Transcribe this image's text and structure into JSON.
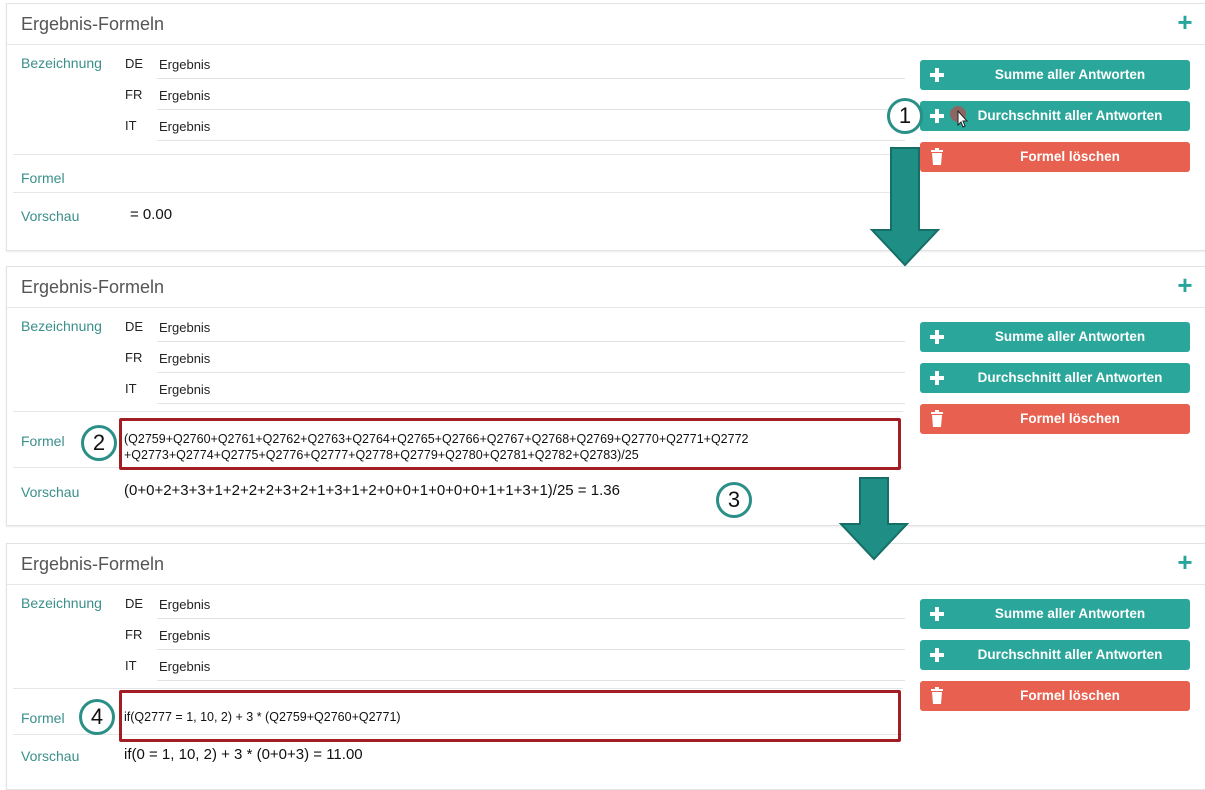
{
  "panels": [
    {
      "title": "Ergebnis-Formeln",
      "bezeichnung_label": "Bezeichnung",
      "langs": [
        {
          "code": "DE",
          "value": "Ergebnis"
        },
        {
          "code": "FR",
          "value": "Ergebnis"
        },
        {
          "code": "IT",
          "value": "Ergebnis"
        }
      ],
      "formel_label": "Formel",
      "formel_line1": "",
      "formel_line2": "",
      "vorschau_label": "Vorschau",
      "vorschau_value": "= 0.00",
      "buttons": {
        "sum": "Summe aller Antworten",
        "avg": "Durchschnitt aller Antworten",
        "delete": "Formel löschen"
      }
    },
    {
      "title": "Ergebnis-Formeln",
      "bezeichnung_label": "Bezeichnung",
      "langs": [
        {
          "code": "DE",
          "value": "Ergebnis"
        },
        {
          "code": "FR",
          "value": "Ergebnis"
        },
        {
          "code": "IT",
          "value": "Ergebnis"
        }
      ],
      "formel_label": "Formel",
      "formel_line1": "(Q2759+Q2760+Q2761+Q2762+Q2763+Q2764+Q2765+Q2766+Q2767+Q2768+Q2769+Q2770+Q2771+Q2772",
      "formel_line2": "+Q2773+Q2774+Q2775+Q2776+Q2777+Q2778+Q2779+Q2780+Q2781+Q2782+Q2783)/25",
      "vorschau_label": "Vorschau",
      "vorschau_value": "(0+0+2+3+3+1+2+2+2+3+2+1+3+1+2+0+0+1+0+0+0+1+1+3+1)/25 = 1.36",
      "buttons": {
        "sum": "Summe aller Antworten",
        "avg": "Durchschnitt aller Antworten",
        "delete": "Formel löschen"
      }
    },
    {
      "title": "Ergebnis-Formeln",
      "bezeichnung_label": "Bezeichnung",
      "langs": [
        {
          "code": "DE",
          "value": "Ergebnis"
        },
        {
          "code": "FR",
          "value": "Ergebnis"
        },
        {
          "code": "IT",
          "value": "Ergebnis"
        }
      ],
      "formel_label": "Formel",
      "formel_line1": "if(Q2777 = 1, 10, 2) + 3 * (Q2759+Q2760+Q2771)",
      "formel_line2": "",
      "vorschau_label": "Vorschau",
      "vorschau_value": "if(0 = 1, 10, 2) + 3 * (0+0+3) = 11.00",
      "buttons": {
        "sum": "Summe aller Antworten",
        "avg": "Durchschnitt aller Antworten",
        "delete": "Formel löschen"
      }
    }
  ],
  "annotations": {
    "step1": "1",
    "step2": "2",
    "step3": "3",
    "step4": "4"
  },
  "icons": {
    "plus": "plus-icon",
    "trash": "trash-icon",
    "cursor": "mouse-cursor-icon",
    "arrow": "arrow-down-icon"
  },
  "colors": {
    "accent": "#2aa69a",
    "danger": "#e8604f",
    "highlight": "#a31e22",
    "label": "#3a8f8a"
  }
}
